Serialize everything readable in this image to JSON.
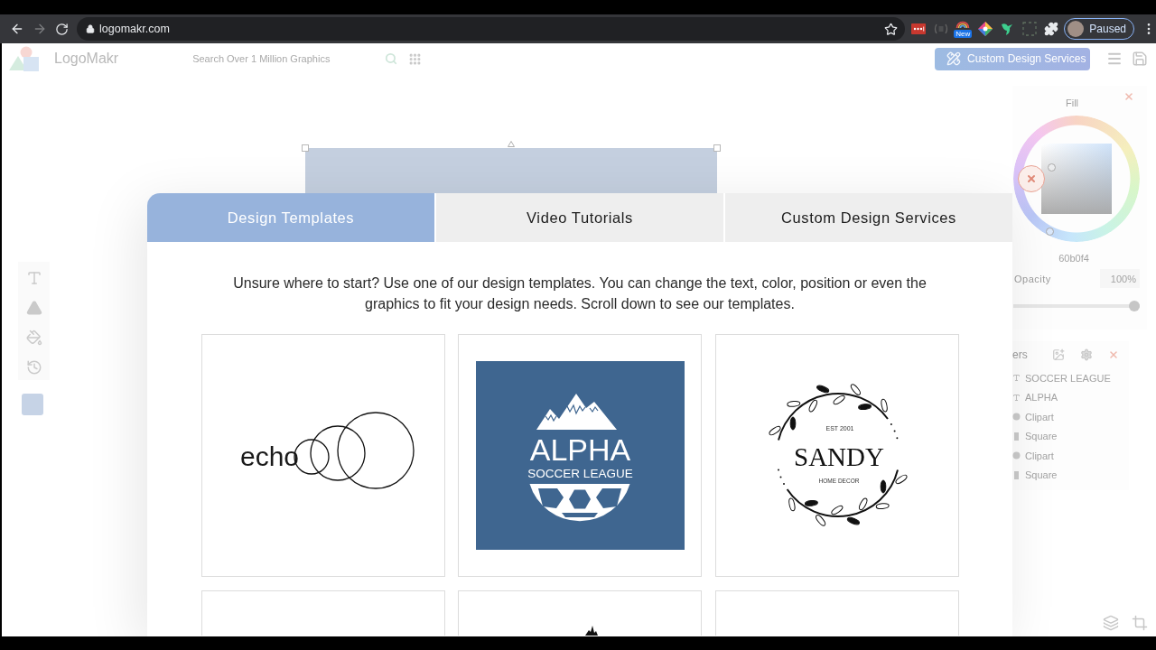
{
  "browser": {
    "forward_disabled": true,
    "url": "logomakr.com",
    "extension_badge": "New",
    "profile_status": "Paused"
  },
  "app_header": {
    "logo_text": "LogoMakr",
    "search": {
      "placeholder": "Search Over 1 Million Graphics"
    },
    "services_button": "Custom Design Services"
  },
  "color_panel": {
    "title": "Fill",
    "hex": "60b0f4",
    "opacity_label": "Opacity",
    "opacity_value": "100%",
    "opacity_slider": {
      "level": 1
    }
  },
  "layers_panel": {
    "title": "ers",
    "layers": [
      {
        "kind": "text",
        "name": "SOCCER LEAGUE"
      },
      {
        "kind": "text",
        "name": "ALPHA"
      },
      {
        "kind": "clipart",
        "name": "Clipart"
      },
      {
        "kind": "shape",
        "name": "Square"
      },
      {
        "kind": "clipart",
        "name": "Clipart"
      },
      {
        "kind": "shape",
        "name": "Square"
      }
    ]
  },
  "modal": {
    "tabs": [
      {
        "label": "Design Templates",
        "selected": true
      },
      {
        "label": "Video Tutorials",
        "selected": false
      },
      {
        "label": "Custom Design Services",
        "selected": false
      }
    ],
    "intro": "Unsure where to start? Use one of our design templates. You can change the text, color, position or even the graphics to fit your design needs. Scroll down to see our templates.",
    "templates": [
      {
        "kind": "echo",
        "wordmark": "echo"
      },
      {
        "kind": "alpha",
        "title": "ALPHA",
        "subtitle": "SOCCER LEAGUE"
      },
      {
        "kind": "sandy",
        "tagline": "EST 2001",
        "title": "SANDY",
        "subtitle": "HOME DECOR"
      },
      {
        "kind": "blank"
      },
      {
        "kind": "peak"
      },
      {
        "kind": "blank"
      }
    ]
  }
}
